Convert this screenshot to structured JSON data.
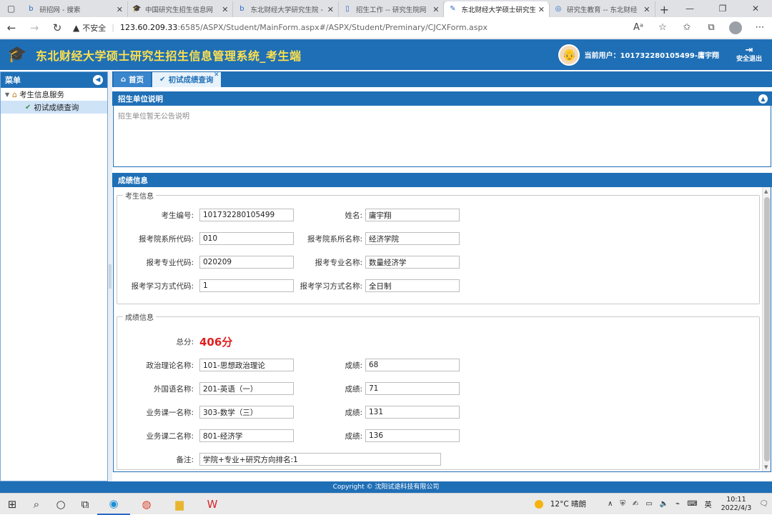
{
  "browser": {
    "tabs": [
      {
        "label": "研招网 - 搜索",
        "icon": "bing-icon",
        "active": false
      },
      {
        "label": "中国研究生招生信息网",
        "icon": "graduation-cap-icon",
        "active": false
      },
      {
        "label": "东北财经大学研究生院 -",
        "icon": "bing-icon",
        "active": false
      },
      {
        "label": "招生工作 -- 研究生院网",
        "icon": "document-icon",
        "active": false
      },
      {
        "label": "东北财经大学硕士研究生",
        "icon": "pencil-icon",
        "active": true
      },
      {
        "label": "研究生教育 -- 东北财经",
        "icon": "globe-icon",
        "active": false
      }
    ],
    "url": {
      "security": "不安全",
      "host": "123.60.209.33",
      "rest": ":6585/ASPX/Student/MainForm.aspx#/ASPX/Student/Preminary/CJCXForm.aspx"
    }
  },
  "app": {
    "title": "东北财经大学硕士研究生招生信息管理系统_考生端",
    "current_user": "当前用户：101732280105499-庸宇翔",
    "logout": "安全退出"
  },
  "sidebar": {
    "title": "菜单",
    "group": "考生信息服务",
    "item": "初试成绩查询"
  },
  "main_tabs": [
    {
      "label": "首页"
    },
    {
      "label": "初试成绩查询"
    }
  ],
  "notice": {
    "title": "招生单位说明",
    "text": "招生单位暂无公告说明"
  },
  "score": {
    "title": "成绩信息",
    "candidate_legend": "考生信息",
    "candidate": [
      {
        "l1": "考生编号:",
        "v1": "101732280105499",
        "l2": "姓名:",
        "v2": "庸宇翔"
      },
      {
        "l1": "报考院系所代码:",
        "v1": "010",
        "l2": "报考院系所名称:",
        "v2": "经济学院"
      },
      {
        "l1": "报考专业代码:",
        "v1": "020209",
        "l2": "报考专业名称:",
        "v2": "数量经济学"
      },
      {
        "l1": "报考学习方式代码:",
        "v1": "1",
        "l2": "报考学习方式名称:",
        "v2": "全日制"
      }
    ],
    "result_legend": "成绩信息",
    "total_label": "总分:",
    "total_value": "406分",
    "subjects": [
      {
        "l1": "政治理论名称:",
        "v1": "101-思想政治理论",
        "l2": "成绩:",
        "v2": "68"
      },
      {
        "l1": "外国语名称:",
        "v1": "201-英语（一）",
        "l2": "成绩:",
        "v2": "71"
      },
      {
        "l1": "业务课一名称:",
        "v1": "303-数学（三）",
        "l2": "成绩:",
        "v2": "131"
      },
      {
        "l1": "业务课二名称:",
        "v1": "801-经济学",
        "l2": "成绩:",
        "v2": "136"
      }
    ],
    "remark_label": "备注:",
    "remark_value": "学院+专业+研究方向排名:1"
  },
  "footer": "Copyright © 沈阳试途科技有限公司",
  "taskbar": {
    "weather": "12°C 晴朗",
    "ime": "英",
    "time": "10:11",
    "date": "2022/4/3"
  },
  "colors": {
    "primary": "#1f6fb6",
    "title_yellow": "#ffe14d",
    "total_red": "#e02020"
  }
}
